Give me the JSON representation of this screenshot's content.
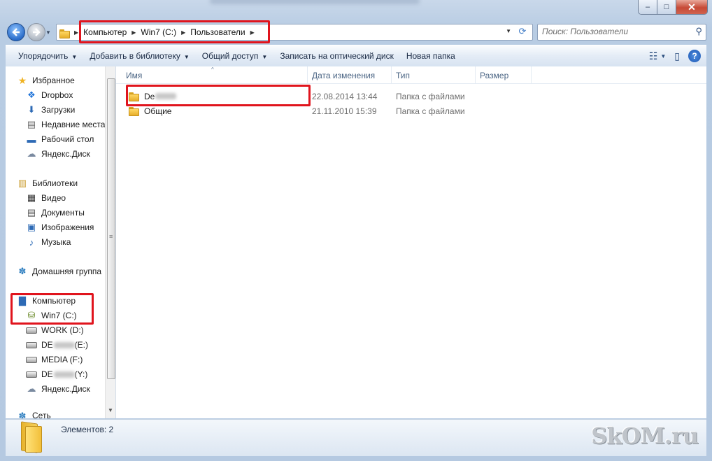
{
  "window": {
    "caption": {
      "minimize": "–",
      "maximize": "□",
      "close": "✕"
    }
  },
  "address": {
    "segments": [
      "Компьютер",
      "Win7 (C:)",
      "Пользователи"
    ],
    "separator": "▶",
    "dropdown": "▼",
    "refresh": "⟳"
  },
  "search": {
    "placeholder": "Поиск: Пользователи",
    "icon": "magnifier-icon"
  },
  "toolbar": {
    "organize": "Упорядочить",
    "add_to_library": "Добавить в библиотеку",
    "share": "Общий доступ",
    "burn": "Записать на оптический диск",
    "new_folder": "Новая папка",
    "dropdown_arrow": "▼",
    "help": "?"
  },
  "sidebar": {
    "favorites": {
      "label": "Избранное",
      "items": [
        "Dropbox",
        "Загрузки",
        "Недавние места",
        "Рабочий стол",
        "Яндекс.Диск"
      ]
    },
    "libraries": {
      "label": "Библиотеки",
      "items": [
        "Видео",
        "Документы",
        "Изображения",
        "Музыка"
      ]
    },
    "homegroup": {
      "label": "Домашняя группа"
    },
    "computer": {
      "label": "Компьютер",
      "drives": [
        {
          "label": "Win7 (C:)"
        },
        {
          "label": "WORK (D:)"
        },
        {
          "label_prefix": "DE",
          "label_suffix": " (E:)"
        },
        {
          "label": "MEDIA (F:)"
        },
        {
          "label_prefix": "DE",
          "label_suffix": " (Y:)"
        },
        {
          "label": "Яндекс.Диск"
        }
      ]
    },
    "network_partial": "Сеть",
    "scroll_grip": "≡"
  },
  "columns": {
    "name": "Имя",
    "date": "Дата изменения",
    "type": "Тип",
    "size": "Размер",
    "sort_arrow": "^"
  },
  "files": [
    {
      "name_prefix": "De",
      "date": "22.08.2014 13:44",
      "type": "Папка с файлами"
    },
    {
      "name": "Общие",
      "date": "21.11.2010 15:39",
      "type": "Папка с файлами"
    }
  ],
  "status": {
    "items_count": "Элементов: 2"
  },
  "watermark": "SkOM.ru",
  "colors": {
    "highlight": "#e0141d",
    "accent": "#2d6ab5"
  }
}
